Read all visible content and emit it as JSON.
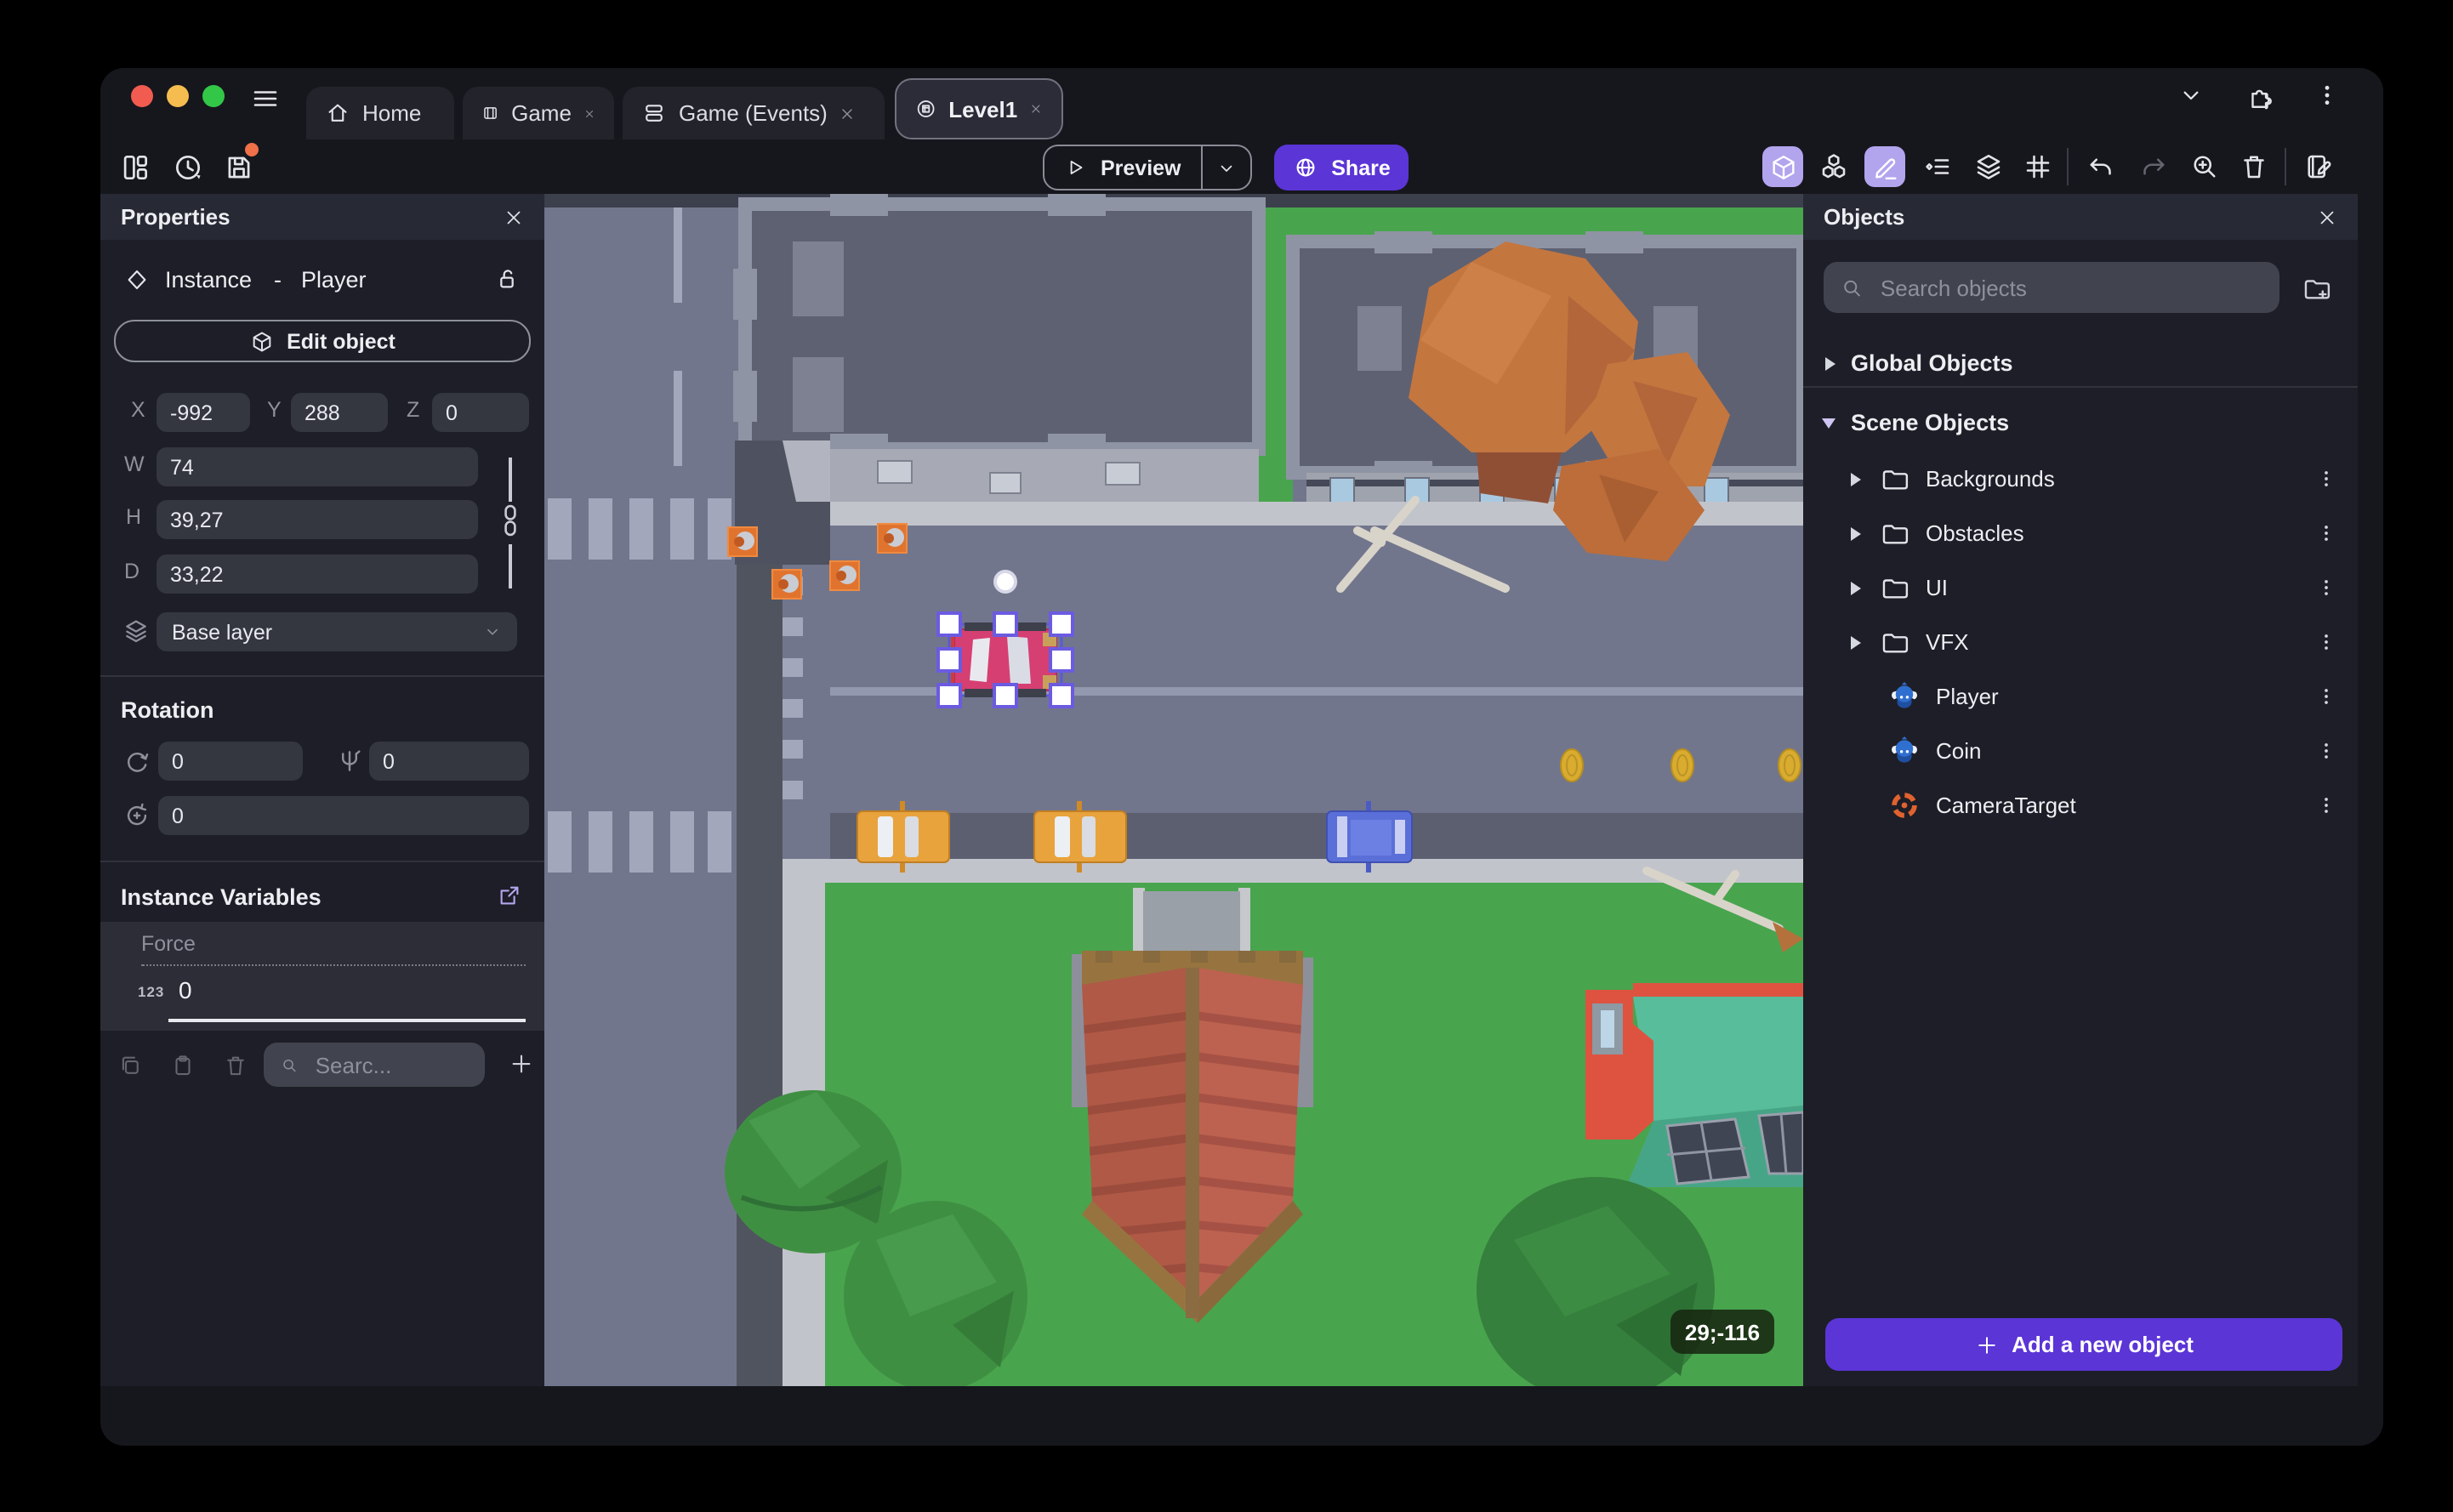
{
  "colors": {
    "accent": "#5b35d6",
    "accent_light": "#b3a4ee",
    "selection": "#6b5be0",
    "close_light": "#f15b50",
    "minimize_light": "#f5bd4f",
    "maximize_light": "#33c748",
    "save_badge": "#f07048"
  },
  "window": {
    "tabs": [
      {
        "label": "Home",
        "closable": false
      },
      {
        "label": "Game",
        "closable": true
      },
      {
        "label": "Game (Events)",
        "closable": true
      },
      {
        "label": "Level1",
        "closable": true,
        "active": true
      }
    ]
  },
  "toolbar": {
    "preview_label": "Preview",
    "share_label": "Share"
  },
  "properties": {
    "title": "Properties",
    "instance_type": "Instance",
    "separator": "-",
    "instance_name": "Player",
    "edit_object_label": "Edit object",
    "pos": {
      "x_label": "X",
      "x": "-992",
      "y_label": "Y",
      "y": "288",
      "z_label": "Z",
      "z": "0"
    },
    "size": {
      "w_label": "W",
      "w": "74",
      "h_label": "H",
      "h": "39,27",
      "d_label": "D",
      "d": "33,22"
    },
    "layer_value": "Base layer",
    "rotation_title": "Rotation",
    "rotation_x": "0",
    "rotation_y": "0",
    "rotation_z": "0",
    "variables_title": "Instance Variables",
    "variable": {
      "name": "Force",
      "type_badge": "123",
      "value": "0"
    },
    "variables_search_placeholder": "Searc..."
  },
  "scene": {
    "coordinates_badge": "29;-116"
  },
  "objects": {
    "title": "Objects",
    "search_placeholder": "Search objects",
    "global_section_label": "Global Objects",
    "scene_section_label": "Scene Objects",
    "folders": [
      "Backgrounds",
      "Obstacles",
      "UI",
      "VFX"
    ],
    "items": [
      {
        "label": "Player"
      },
      {
        "label": "Coin"
      },
      {
        "label": "CameraTarget"
      }
    ],
    "add_button_label": "Add a new object"
  }
}
